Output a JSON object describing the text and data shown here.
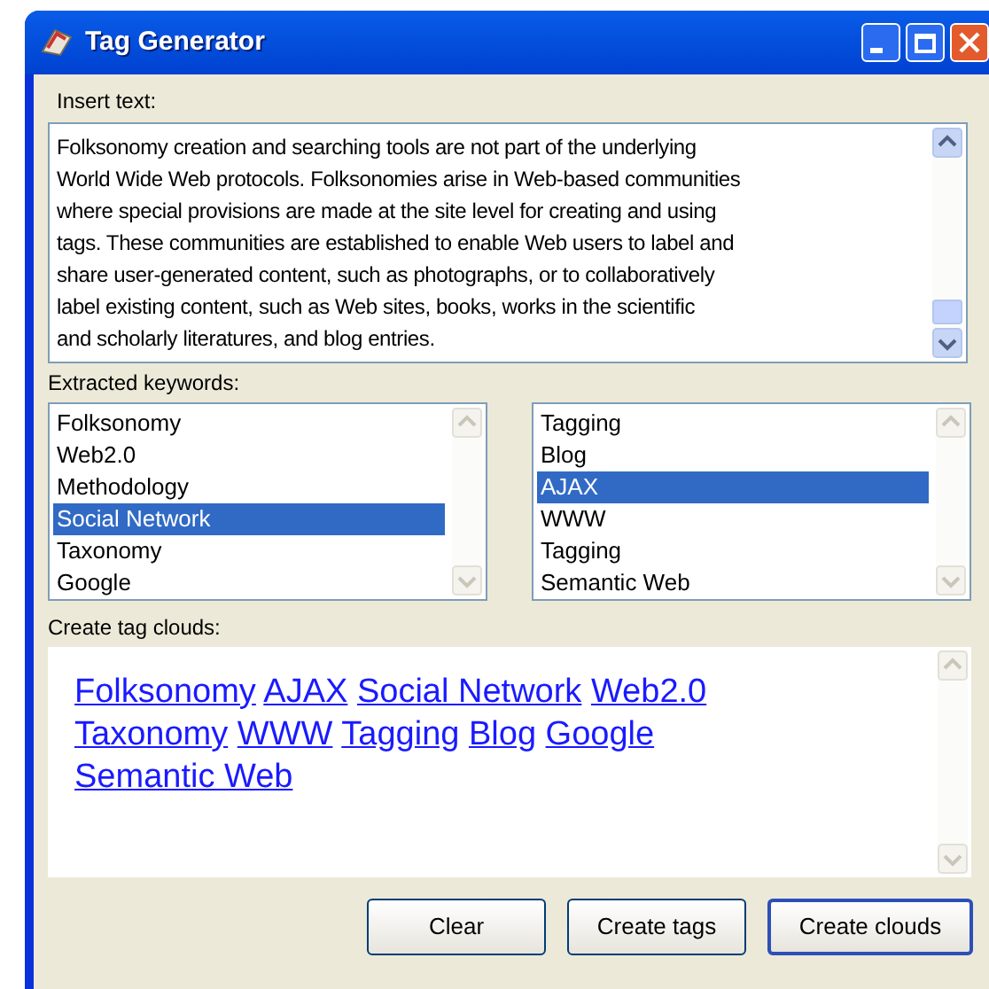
{
  "window": {
    "title": "Tag Generator"
  },
  "insert_text": {
    "label": "Insert text:",
    "lines": [
      "Folksonomy creation and searching tools are not part of the underlying",
      "World Wide Web protocols. Folksonomies arise in Web-based communities",
      "where special provisions are made at the site level for creating and using",
      "tags. These communities are established to enable Web users to label and",
      "share user-generated content, such as photographs, or to collaboratively",
      "label existing content, such as Web sites, books, works in the scientific",
      "and scholarly literatures, and blog entries."
    ]
  },
  "keywords": {
    "label": "Extracted keywords:",
    "lists": [
      [
        {
          "label": "Folksonomy",
          "selected": false
        },
        {
          "label": "Web2.0",
          "selected": false
        },
        {
          "label": "Methodology",
          "selected": false
        },
        {
          "label": "Social Network",
          "selected": true
        },
        {
          "label": "Taxonomy",
          "selected": false
        },
        {
          "label": "Google",
          "selected": false
        }
      ],
      [
        {
          "label": "Tagging",
          "selected": false
        },
        {
          "label": "Blog",
          "selected": false
        },
        {
          "label": "AJAX",
          "selected": true
        },
        {
          "label": "WWW",
          "selected": false
        },
        {
          "label": "Tagging",
          "selected": false
        },
        {
          "label": "Semantic Web",
          "selected": false
        }
      ]
    ]
  },
  "tag_cloud": {
    "label": "Create tag clouds:",
    "tags": [
      "Folksonomy",
      "AJAX",
      "Social Network",
      "Web2.0",
      "Taxonomy",
      "WWW",
      "Tagging",
      "Blog",
      "Google",
      "Semantic Web"
    ]
  },
  "buttons": [
    {
      "label": "Clear",
      "default": false
    },
    {
      "label": "Create tags",
      "default": false
    },
    {
      "label": "Create clouds",
      "default": true
    }
  ]
}
